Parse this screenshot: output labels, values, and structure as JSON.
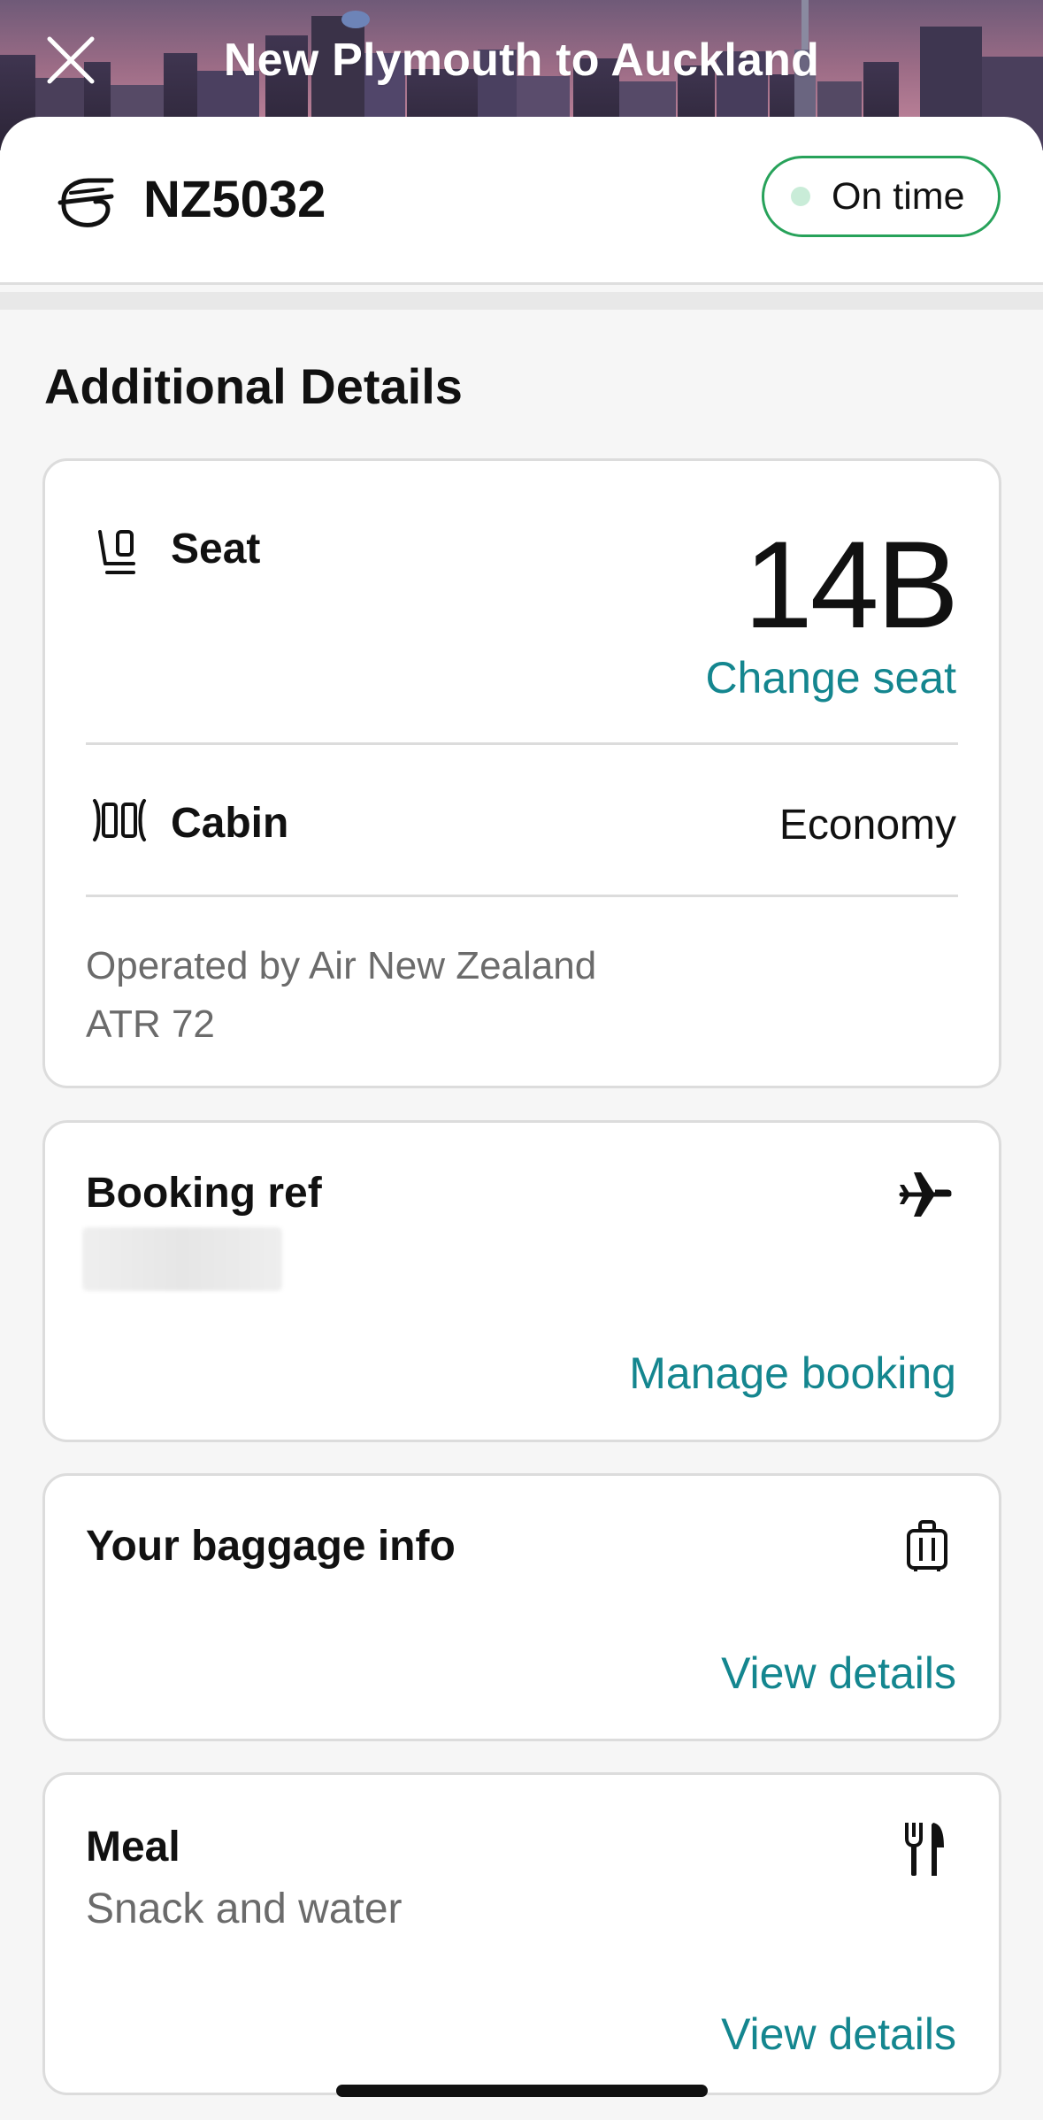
{
  "header": {
    "title": "New Plymouth to Auckland",
    "close_icon": "close-icon"
  },
  "flight": {
    "number": "NZ5032",
    "airline_logo": "air-new-zealand-logo-icon",
    "status": "On time",
    "status_color": "#27a25a"
  },
  "section_title": "Additional Details",
  "seat_card": {
    "seat_label": "Seat",
    "seat_icon": "seat-icon",
    "seat_value": "14B",
    "change_seat": "Change seat",
    "cabin_label": "Cabin",
    "cabin_icon": "cabin-icon",
    "cabin_value": "Economy",
    "operated_by": "Operated by Air New Zealand",
    "aircraft": "ATR 72"
  },
  "booking_card": {
    "label": "Booking ref",
    "icon": "plane-icon",
    "manage_link": "Manage booking"
  },
  "baggage_card": {
    "label": "Your baggage info",
    "icon": "luggage-icon",
    "link": "View details"
  },
  "meal_card": {
    "label": "Meal",
    "value": "Snack and water",
    "icon": "cutlery-icon",
    "link": "View details"
  },
  "colors": {
    "accent_link": "#14868f",
    "status_green": "#27a25a"
  }
}
